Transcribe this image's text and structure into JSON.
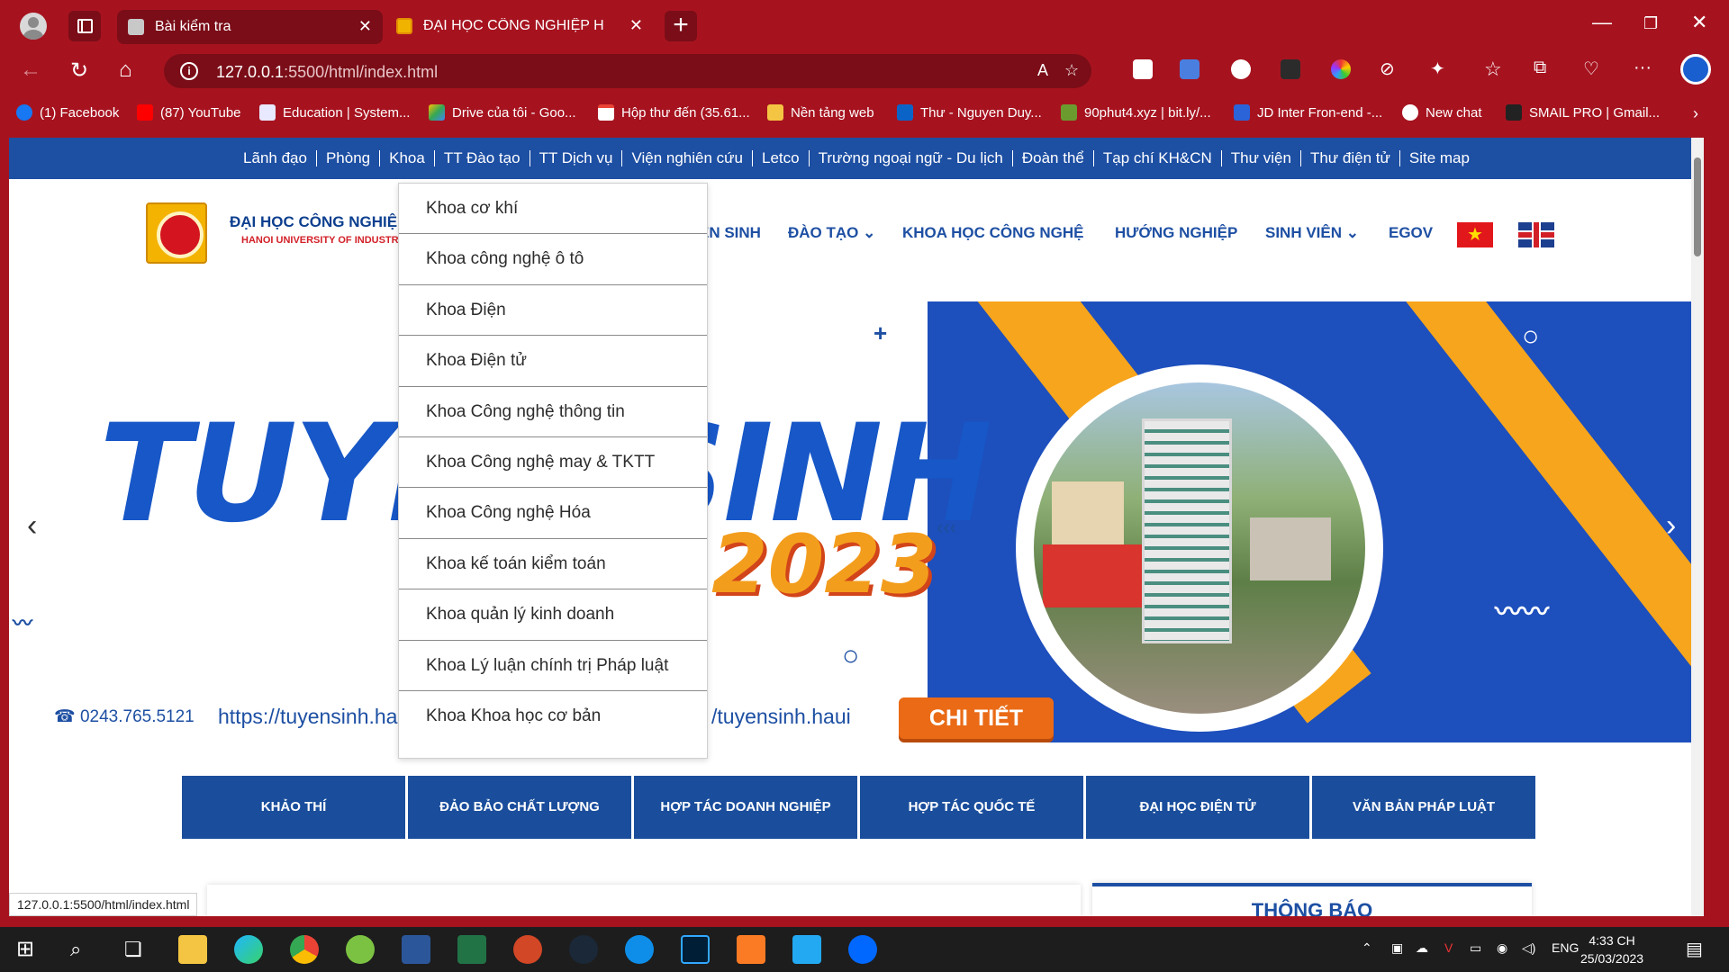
{
  "tabs": [
    {
      "title": "Bài kiểm tra"
    },
    {
      "title": "ĐẠI HỌC CÔNG NGHIỆP HÀ NỘI"
    }
  ],
  "address": {
    "host": "127.0.0.1",
    "path": ":5500/html/index.html"
  },
  "bookmarks": [
    "(1) Facebook",
    "(87) YouTube",
    "Education | System...",
    "Drive của tôi - Goo...",
    "Hộp thư đến (35.61...",
    "Nền tảng web",
    "Thư - Nguyen Duy...",
    "90phut4.xyz | bit.ly/...",
    "JD Inter Fron-end -...",
    "New chat",
    "SMAIL PRO | Gmail..."
  ],
  "topnav": [
    "Lãnh đạo",
    "Phòng",
    "Khoa",
    "TT Đào tạo",
    "TT Dịch vụ",
    "Viện nghiên cứu",
    "Letco",
    "Trường ngoại ngữ - Du lịch",
    "Đoàn thể",
    "Tạp chí KH&CN",
    "Thư viện",
    "Thư điện tử",
    "Site map"
  ],
  "header": {
    "school_name": "ĐẠI HỌC CÔNG NGHIỆP HÀ NỘI",
    "school_sub": "HANOI UNIVERSITY OF INDUSTRY",
    "nav": {
      "tuyensinh": "EN SINH",
      "daotao": "ĐÀO TẠO",
      "khcn": "KHOA HỌC CÔNG NGHỆ",
      "huongnghiep": "HƯỚNG NGHIỆP",
      "sinhvien": "SINH VIÊN",
      "egov": "EGOV"
    }
  },
  "banner": {
    "title": "TUYỂN SINH",
    "year": "2023",
    "phone": "0243.765.5121",
    "website": "https://tuyensinh.haui",
    "website_tail": "/tuyensinh.haui",
    "cta": "CHI TIẾT"
  },
  "dropdown": [
    "Khoa cơ khí",
    "Khoa công nghệ ô tô",
    "Khoa Điện",
    "Khoa Điện tử",
    "Khoa Công nghệ thông tin",
    "Khoa Công nghệ may & TKTT",
    "Khoa Công nghệ Hóa",
    "Khoa kế toán kiểm toán",
    "Khoa quản lý kinh doanh",
    "Khoa Lý luận chính trị Pháp luật",
    "Khoa Khoa học cơ bản"
  ],
  "quicklinks": [
    "KHẢO THÍ",
    "ĐẢO BẢO CHẤT LƯỢNG",
    "HỢP TÁC DOANH NGHIỆP",
    "HỢP TÁC QUỐC TẾ",
    "ĐẠI HỌC ĐIỆN TỬ",
    "VĂN BẢN PHÁP LUẬT"
  ],
  "notice_title": "THÔNG BÁO",
  "status_url": "127.0.0.1:5500/html/index.html",
  "taskbar": {
    "lang": "ENG",
    "time": "4:33 CH",
    "date": "25/03/2023"
  },
  "colors": {
    "browser": "#a6131f",
    "brand_blue": "#1d4fa3",
    "accent_orange": "#f39d1d"
  }
}
